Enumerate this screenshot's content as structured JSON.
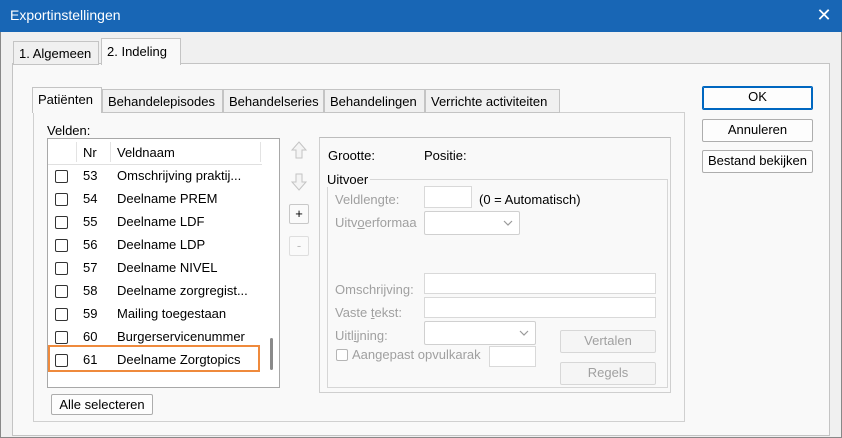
{
  "window": {
    "title": "Exportinstellingen",
    "close_glyph": "✕"
  },
  "outer_tabs": [
    {
      "label": "1. Algemeen",
      "active": false
    },
    {
      "label": "2. Indeling",
      "active": true
    }
  ],
  "inner_tabs": [
    {
      "label": "Patiënten",
      "active": true
    },
    {
      "label": "Behandelepisodes",
      "active": false
    },
    {
      "label": "Behandelseries",
      "active": false
    },
    {
      "label": "Behandelingen",
      "active": false
    },
    {
      "label": "Verrichte activiteiten",
      "active": false
    }
  ],
  "fields_list": {
    "label": "Velden:",
    "col_nr": "Nr",
    "col_name": "Veldnaam",
    "rows": [
      {
        "nr": "53",
        "name": "Omschrijving praktij...",
        "checked": false
      },
      {
        "nr": "54",
        "name": "Deelname PREM",
        "checked": false
      },
      {
        "nr": "55",
        "name": "Deelname LDF",
        "checked": false
      },
      {
        "nr": "56",
        "name": "Deelname LDP",
        "checked": false
      },
      {
        "nr": "57",
        "name": "Deelname NIVEL",
        "checked": false
      },
      {
        "nr": "58",
        "name": "Deelname zorgregist...",
        "checked": false
      },
      {
        "nr": "59",
        "name": "Mailing toegestaan",
        "checked": false
      },
      {
        "nr": "60",
        "name": "Burgerservicenummer",
        "checked": false
      },
      {
        "nr": "61",
        "name": "Deelname Zorgtopics",
        "checked": false
      }
    ],
    "select_all": "Alle selecteren"
  },
  "side_buttons": {
    "add": "+",
    "remove": "-"
  },
  "details": {
    "size_label": "Grootte:",
    "position_label": "Positie:",
    "output_group": "Uitvoer",
    "length_label_pre": "Veldlen",
    "length_label_u": "g",
    "length_label_post": "te:",
    "length_value": "",
    "length_hint": "(0 = Automatisch)",
    "format_label_pre": "Uitv",
    "format_label_u": "o",
    "format_label_post": "erformaa",
    "description_label": "Omschrijving:",
    "fixed_text_pre": "Vaste ",
    "fixed_text_u": "t",
    "fixed_text_post": "ekst:",
    "alignment_pre": "Uitl",
    "alignment_u": "i",
    "alignment_post": "jning:",
    "custom_fill": "Aangepast opvulkarak",
    "translate": "Vertalen",
    "rules": "Regels"
  },
  "actions": {
    "ok": "OK",
    "cancel": "Annuleren",
    "view_file": "Bestand bekijken"
  },
  "colors": {
    "titlebar": "#1866b5",
    "highlight": "#ef8a3c"
  }
}
